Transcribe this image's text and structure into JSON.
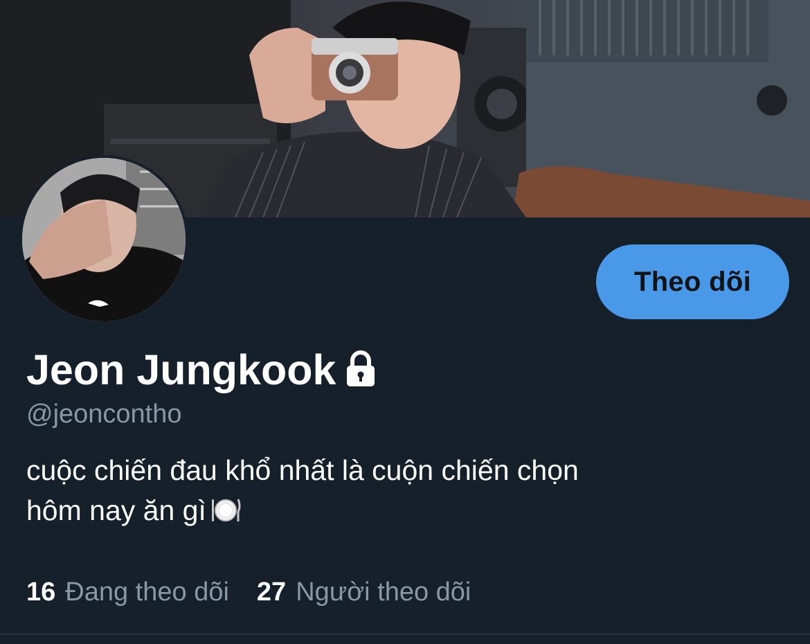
{
  "profile": {
    "display_name": "Jeon Jungkook",
    "handle": "@jeoncontho",
    "locked_icon": "lock-icon",
    "bio_line1": "cuộc chiến đau khổ nhất là cuộn chiến chọn",
    "bio_line2": "hôm nay ăn gì",
    "bio_emoji_icon": "plate-fork-knife-icon"
  },
  "actions": {
    "follow_label": "Theo dõi",
    "follow_color": "#4a99e9"
  },
  "stats": {
    "following_count": "16",
    "following_label": "Đang theo dõi",
    "followers_count": "27",
    "followers_label": "Người theo dõi"
  },
  "colors": {
    "background": "#15202b",
    "secondary_text": "#8899a6"
  }
}
